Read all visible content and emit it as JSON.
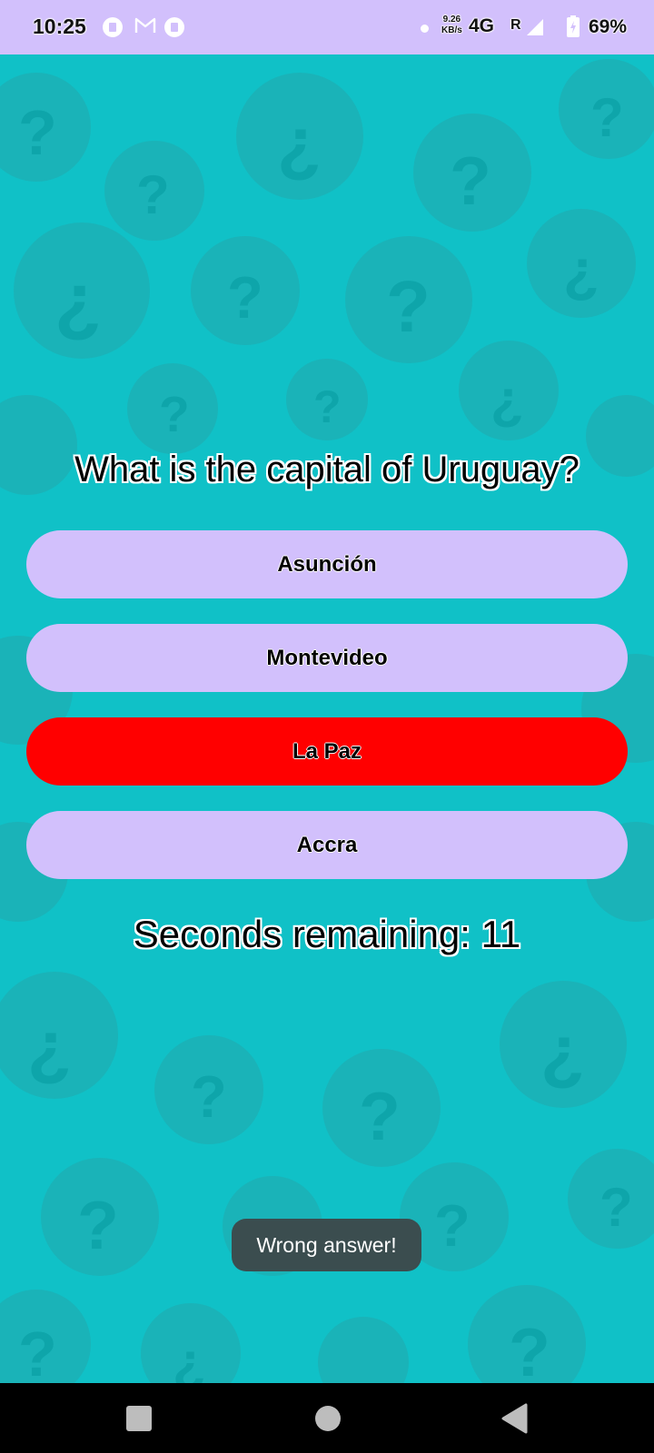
{
  "status_bar": {
    "time": "10:25",
    "notification_icons": [
      "app-icon",
      "gmail-icon",
      "app-icon"
    ],
    "net_speed_value": "9.26",
    "net_speed_unit": "KB/s",
    "network": "4G",
    "roaming": "R",
    "battery_percent": "69%",
    "background_color": "#d2c0fc"
  },
  "quiz": {
    "question": "What is the capital of Uruguay?",
    "answers": [
      {
        "label": "Asunción",
        "color": "#d2c0fc"
      },
      {
        "label": "Montevideo",
        "color": "#d2c0fc"
      },
      {
        "label": "La Paz",
        "color": "#ff0000"
      },
      {
        "label": "Accra",
        "color": "#d2c0fc"
      }
    ],
    "timer_text": "Seconds remaining: 11",
    "background_color": "#10c1c7"
  },
  "toast": {
    "message": "Wrong answer!"
  },
  "nav_bar": {
    "icons": [
      "recent-apps-icon",
      "home-icon",
      "back-icon"
    ]
  }
}
